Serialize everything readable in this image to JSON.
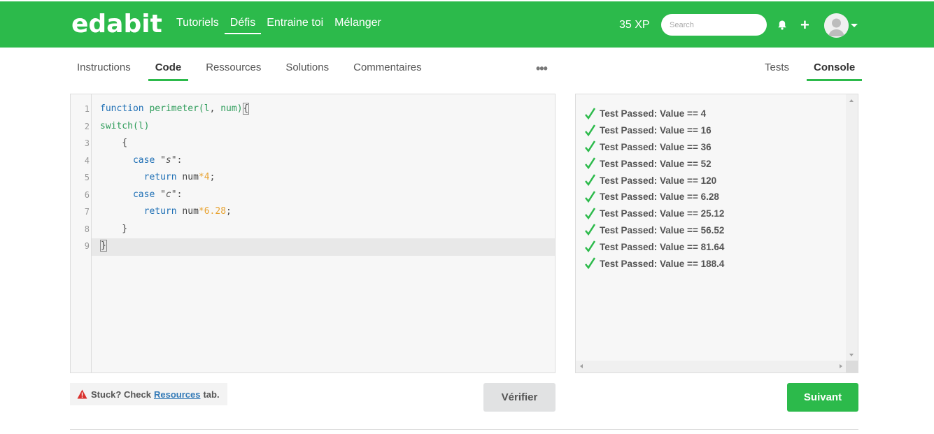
{
  "header": {
    "logo": "edabit",
    "nav": [
      {
        "label": "Tutoriels"
      },
      {
        "label": "Défis",
        "active": true
      },
      {
        "label": "Entraine toi"
      },
      {
        "label": "Mélanger"
      }
    ],
    "xp": "35 XP",
    "search_placeholder": "Search",
    "brand_color": "#2cba4b"
  },
  "tabs_left": [
    "Instructions",
    "Code",
    "Ressources",
    "Solutions",
    "Commentaires"
  ],
  "tabs_left_active": "Code",
  "more_label": "•••",
  "tabs_right": [
    "Tests",
    "Console"
  ],
  "tabs_right_active": "Console",
  "editor": {
    "line_numbers": [
      "1",
      "2",
      "3",
      "4",
      "5",
      "6",
      "7",
      "8",
      "9"
    ]
  },
  "console": {
    "results": [
      "Test Passed: Value == 4",
      "Test Passed: Value == 16",
      "Test Passed: Value == 36",
      "Test Passed: Value == 52",
      "Test Passed: Value == 120",
      "Test Passed: Value == 6.28",
      "Test Passed: Value == 25.12",
      "Test Passed: Value == 56.52",
      "Test Passed: Value == 81.64",
      "Test Passed: Value == 188.4"
    ]
  },
  "bottom": {
    "stuck_prefix": "Stuck? Check",
    "stuck_link": "Resources",
    "stuck_suffix": "tab.",
    "verify_label": "Vérifier",
    "next_label": "Suivant"
  }
}
